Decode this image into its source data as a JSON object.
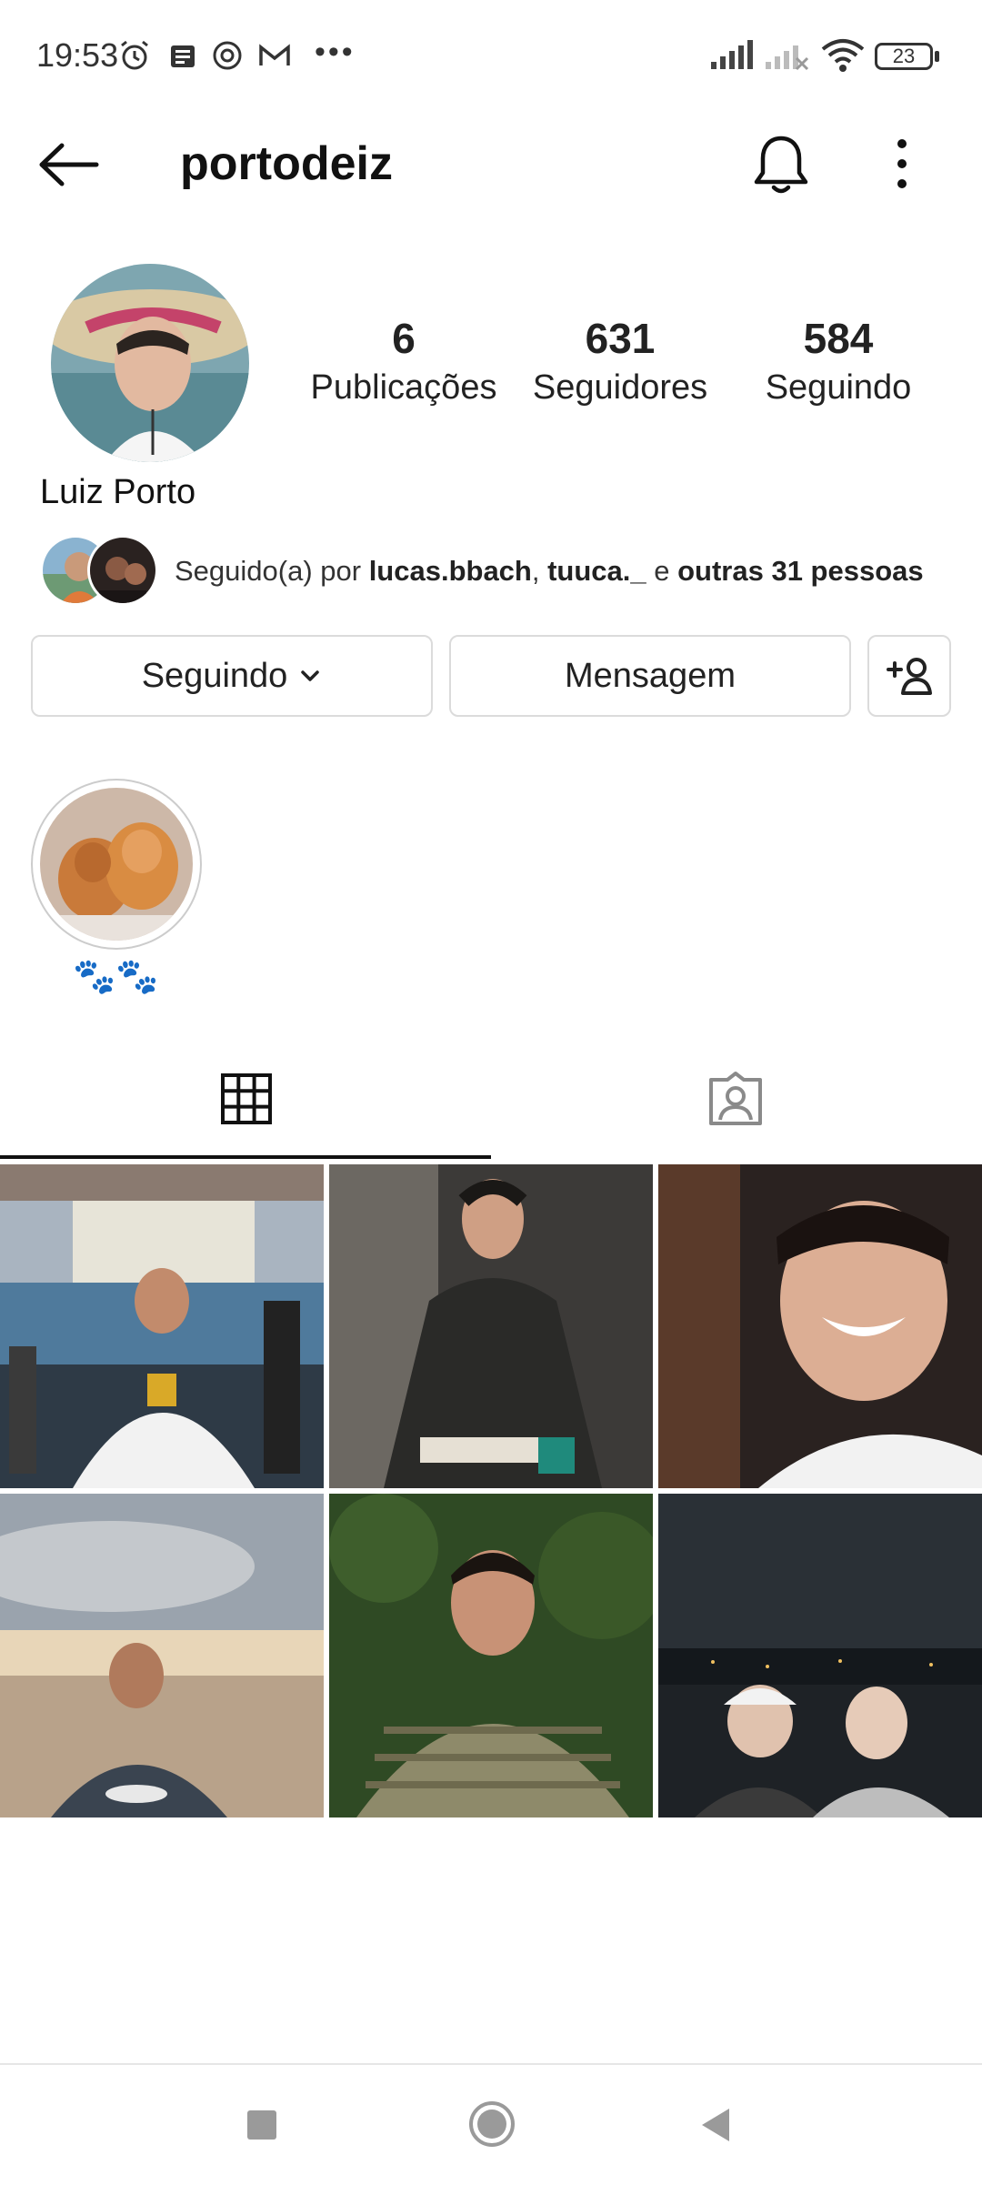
{
  "status_bar": {
    "time": "19:53",
    "battery": "23"
  },
  "header": {
    "username": "portodeiz",
    "icons": [
      "back-arrow-icon",
      "bell-icon",
      "more-vertical-icon"
    ]
  },
  "profile": {
    "full_name": "Luiz Porto",
    "stats": [
      {
        "value": "6",
        "label": "Publicações"
      },
      {
        "value": "631",
        "label": "Seguidores"
      },
      {
        "value": "584",
        "label": "Seguindo"
      }
    ],
    "followed_by": {
      "prefix": "Seguido(a) por ",
      "user1": "lucas.bbach",
      "sep": ", ",
      "user2": "tuuca._",
      "joiner": " e ",
      "others": "outras 31 pessoas"
    }
  },
  "actions": {
    "following_label": "Seguindo",
    "message_label": "Mensagem"
  },
  "highlights": [
    {
      "label": "🐾🐾"
    }
  ],
  "tabs": [
    "grid-icon",
    "tagged-icon"
  ],
  "posts_count": 6,
  "colors": {
    "highlight_label": "#1d5fd0",
    "text": "#262626"
  }
}
